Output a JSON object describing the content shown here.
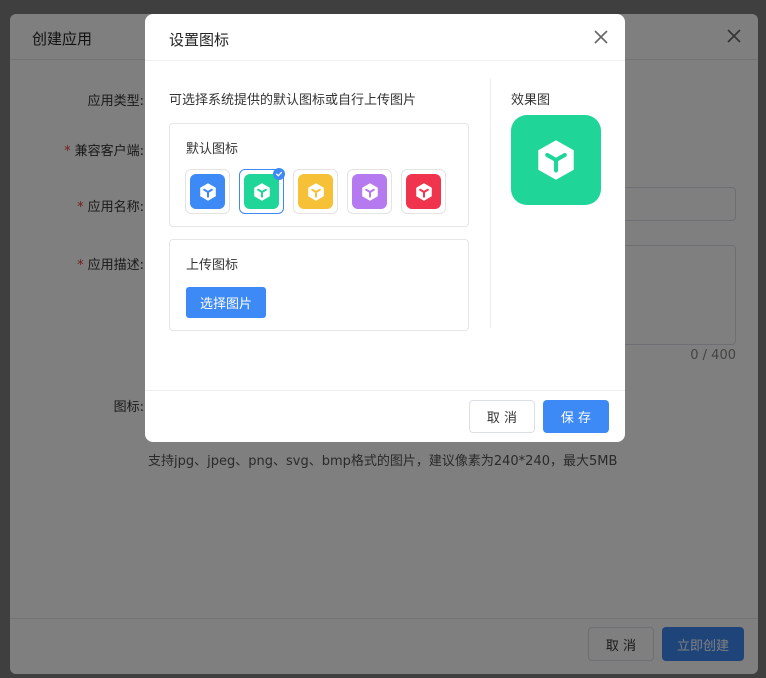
{
  "background_dialog": {
    "title": "创建应用",
    "labels": {
      "app_type": "应用类型:",
      "compatible_client": "兼容客户端:",
      "app_name": "应用名称:",
      "app_desc": "应用描述:",
      "icon": "图标:"
    },
    "required_mark": "*",
    "desc_counter": "0 / 400",
    "upload_hint": "支持jpg、jpeg、png、svg、bmp格式的图片，建议像素为240*240，最大5MB",
    "cancel_label": "取 消",
    "create_label": "立即创建",
    "accent_color": "#3d89f5"
  },
  "icon_dialog": {
    "title": "设置图标",
    "hint": "可选择系统提供的默认图标或自行上传图片",
    "default_section_title": "默认图标",
    "default_icons": [
      {
        "icon": "cube-icon",
        "color": "#3d89f5",
        "selected": false
      },
      {
        "icon": "cube-icon",
        "color": "#1fd698",
        "selected": true
      },
      {
        "icon": "cube-icon",
        "color": "#f7c137",
        "selected": false
      },
      {
        "icon": "cube-icon",
        "color": "#b57af0",
        "selected": false
      },
      {
        "icon": "cube-icon",
        "color": "#f0344d",
        "selected": false
      }
    ],
    "upload_section_title": "上传图标",
    "upload_button_label": "选择图片",
    "preview_title": "效果图",
    "preview_color": "#1fd698",
    "cancel_label": "取 消",
    "save_label": "保 存"
  }
}
